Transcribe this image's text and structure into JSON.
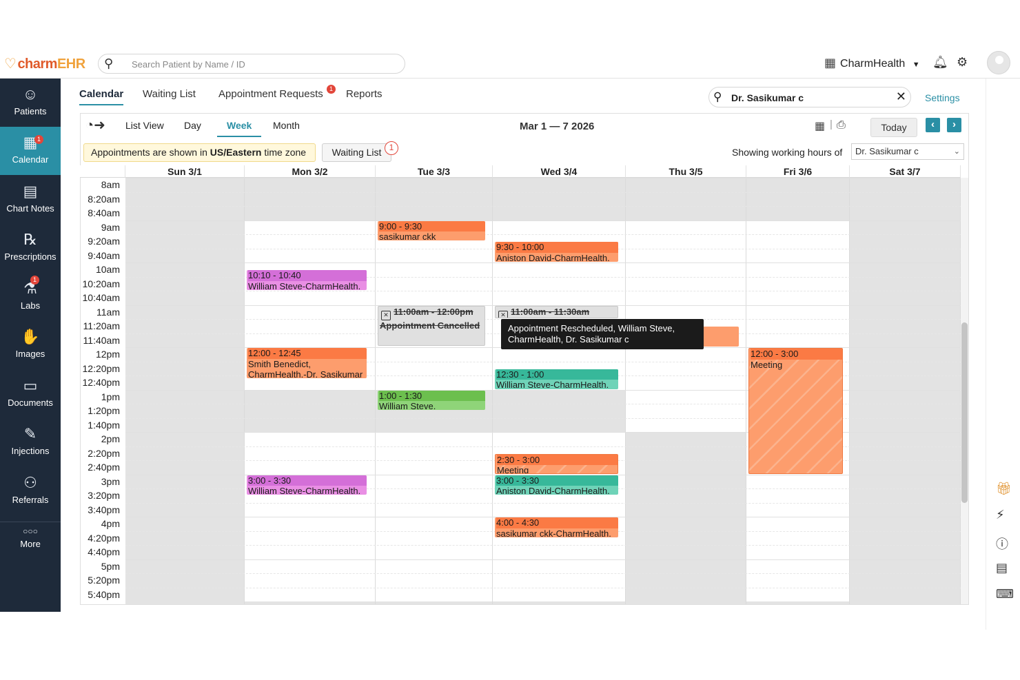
{
  "app": {
    "logo_main": "charm",
    "logo_sub": "EHR",
    "search_placeholder": "Search Patient by Name / ID",
    "org_name": "CharmHealth"
  },
  "sidebar": {
    "items": [
      {
        "label": "Patients",
        "icon": "patients-icon"
      },
      {
        "label": "Calendar",
        "icon": "calendar-icon",
        "badge": "1"
      },
      {
        "label": "Chart Notes",
        "icon": "chart-notes-icon"
      },
      {
        "label": "Prescriptions",
        "icon": "prescriptions-icon"
      },
      {
        "label": "Labs",
        "icon": "labs-icon",
        "badge": "1"
      },
      {
        "label": "Images",
        "icon": "images-icon"
      },
      {
        "label": "Documents",
        "icon": "documents-icon"
      },
      {
        "label": "Injections",
        "icon": "injections-icon"
      },
      {
        "label": "Referrals",
        "icon": "referrals-icon"
      },
      {
        "label": "More",
        "icon": "more-icon"
      }
    ]
  },
  "tabs": {
    "calendar": "Calendar",
    "waiting_list": "Waiting List",
    "appointment_requests": "Appointment Requests",
    "appointment_requests_badge": "1",
    "reports": "Reports"
  },
  "provider_search": {
    "value": "Dr. Sasikumar c"
  },
  "settings_label": "Settings",
  "views": {
    "list": "List View",
    "day": "Day",
    "week": "Week",
    "month": "Month"
  },
  "date_range": "Mar 1 — 7 2026",
  "today_label": "Today",
  "timezone_note": {
    "prefix": "Appointments are shown in ",
    "zone": "US/Eastern",
    "suffix": " time zone"
  },
  "waiting_list_button": "Waiting List",
  "waiting_list_count": "1",
  "showing_label": "Showing working hours of",
  "showing_value": "Dr. Sasikumar c",
  "days": [
    "Sun 3/1",
    "Mon 3/2",
    "Tue 3/3",
    "Wed 3/4",
    "Thu 3/5",
    "Fri 3/6",
    "Sat 3/7"
  ],
  "times": [
    "8am",
    "8:20am",
    "8:40am",
    "9am",
    "9:20am",
    "9:40am",
    "10am",
    "10:20am",
    "10:40am",
    "11am",
    "11:20am",
    "11:40am",
    "12pm",
    "12:20pm",
    "12:40pm",
    "1pm",
    "1:20pm",
    "1:40pm",
    "2pm",
    "2:20pm",
    "2:40pm",
    "3pm",
    "3:20pm",
    "3:40pm",
    "4pm",
    "4:20pm",
    "4:40pm",
    "5pm",
    "5:20pm",
    "5:40pm"
  ],
  "appointments": [
    {
      "day": 2,
      "time": "9:00 - 9:30",
      "text": "sasikumar ckk",
      "color": "orange"
    },
    {
      "day": 3,
      "time": "9:30 - 10:00",
      "text": "Aniston David-CharmHealth.",
      "color": "orange"
    },
    {
      "day": 1,
      "time": "10:10 - 10:40",
      "text": "William Steve-CharmHealth.",
      "color": "pink"
    },
    {
      "day": 2,
      "time": "11:00am - 12:00pm",
      "text": "Appointment Cancelled",
      "color": "cancel"
    },
    {
      "day": 3,
      "time": "11:00am - 11:30am",
      "text": "",
      "color": "cancel"
    },
    {
      "day": 1,
      "time": "12:00 - 12:45",
      "text": "Smith Benedict, CharmHealth.-Dr. Sasikumar",
      "color": "orange"
    },
    {
      "day": 5,
      "time": "12:00 - 3:00",
      "text": "Meeting",
      "color": "meeting"
    },
    {
      "day": 3,
      "time": "12:30 - 1:00",
      "text": "William Steve-CharmHealth.",
      "color": "teal"
    },
    {
      "day": 2,
      "time": "1:00 - 1:30",
      "text": "William Steve.",
      "color": "green"
    },
    {
      "day": 3,
      "time": "2:30 - 3:00",
      "text": "Meeting",
      "color": "meeting"
    },
    {
      "day": 1,
      "time": "3:00 - 3:30",
      "text": "William Steve-CharmHealth.",
      "color": "pink"
    },
    {
      "day": 3,
      "time": "3:00 - 3:30",
      "text": "Aniston David-CharmHealth.",
      "color": "teal"
    },
    {
      "day": 3,
      "time": "4:00 - 4:30",
      "text": "sasikumar ckk-CharmHealth.",
      "color": "orange"
    }
  ],
  "tooltip": "Appointment Rescheduled, William Steve, CharmHealth, Dr. Sasikumar c",
  "colors": {
    "sidebar": "#1e2a3a",
    "accent": "#2a8fa5",
    "orange": "#fb7a44",
    "pink": "#d46fd8",
    "green": "#6cbf4e",
    "teal": "#37b89a"
  }
}
